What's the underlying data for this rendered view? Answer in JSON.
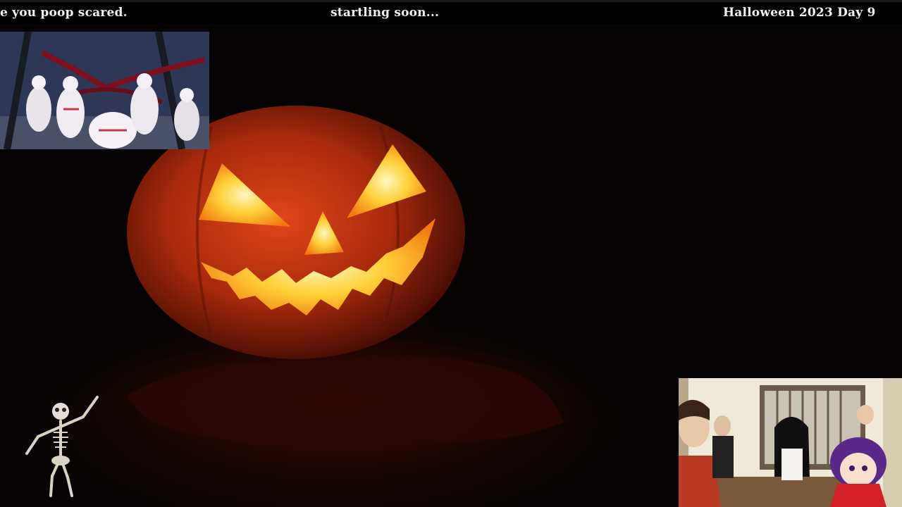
{
  "ticker": {
    "left_text": "e you poop scared.",
    "middle_text": "startling soon...",
    "right_text": "Halloween 2023 Day 9"
  },
  "colors": {
    "background": "#050303",
    "pumpkin_orange": "#c23a10",
    "flame_yellow": "#ffd44a",
    "text": "#f2f2f2"
  },
  "icons": {
    "pumpkin": "jack-o-lantern-icon",
    "skeleton": "dancing-skeleton-icon"
  }
}
